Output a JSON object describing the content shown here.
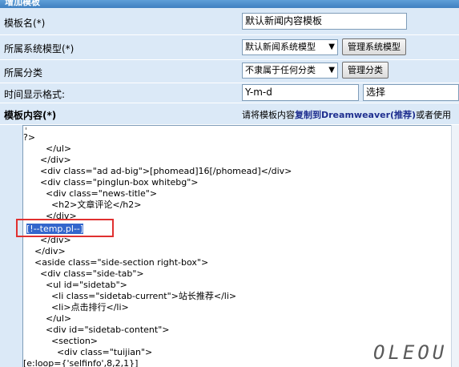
{
  "header": {
    "title": "增加模板"
  },
  "form": {
    "template_name": {
      "label": "模板名(*)",
      "value": "默认新闻内容模板"
    },
    "system_model": {
      "label": "所属系统模型(*)",
      "selected": "默认新闻系统模型",
      "manage_button": "管理系统模型"
    },
    "category": {
      "label": "所属分类",
      "selected": "不隶属于任何分类",
      "manage_button": "管理分类"
    },
    "time_format": {
      "label": "时间显示格式:",
      "value": "Y-m-d",
      "select_value": "选择"
    },
    "content": {
      "label": "模板内容(*)",
      "hint_prefix": "请将模板内容",
      "hint_bold": "复制到Dreamweaver(推荐)",
      "hint_suffix": "或者使用"
    }
  },
  "editor": {
    "lines": [
      "?>",
      "        </ul>",
      "      </div>",
      "      <div class=\"ad ad-big\">[phomead]16[/phomead]</div>",
      "      <div class=\"pinglun-box whitebg\">",
      "        <div class=\"news-title\">",
      "          <h2>文章评论</h2>",
      "        </div>",
      "[!--temp.pl--]",
      "      </div>",
      "    </div>",
      "    <aside class=\"side-section right-box\">",
      "      <div class=\"side-tab\">",
      "        <ul id=\"sidetab\">",
      "          <li class=\"sidetab-current\">站长推荐</li>",
      "          <li>点击排行</li>",
      "        </ul>",
      "        <div id=\"sidetab-content\">",
      "          <section>",
      "            <div class=\"tuijian\">",
      "[e:loop={'selfinfo',8,2,1}]"
    ],
    "highlighted_line": "[!--temp.pl--]"
  },
  "watermark": "OLEOU"
}
